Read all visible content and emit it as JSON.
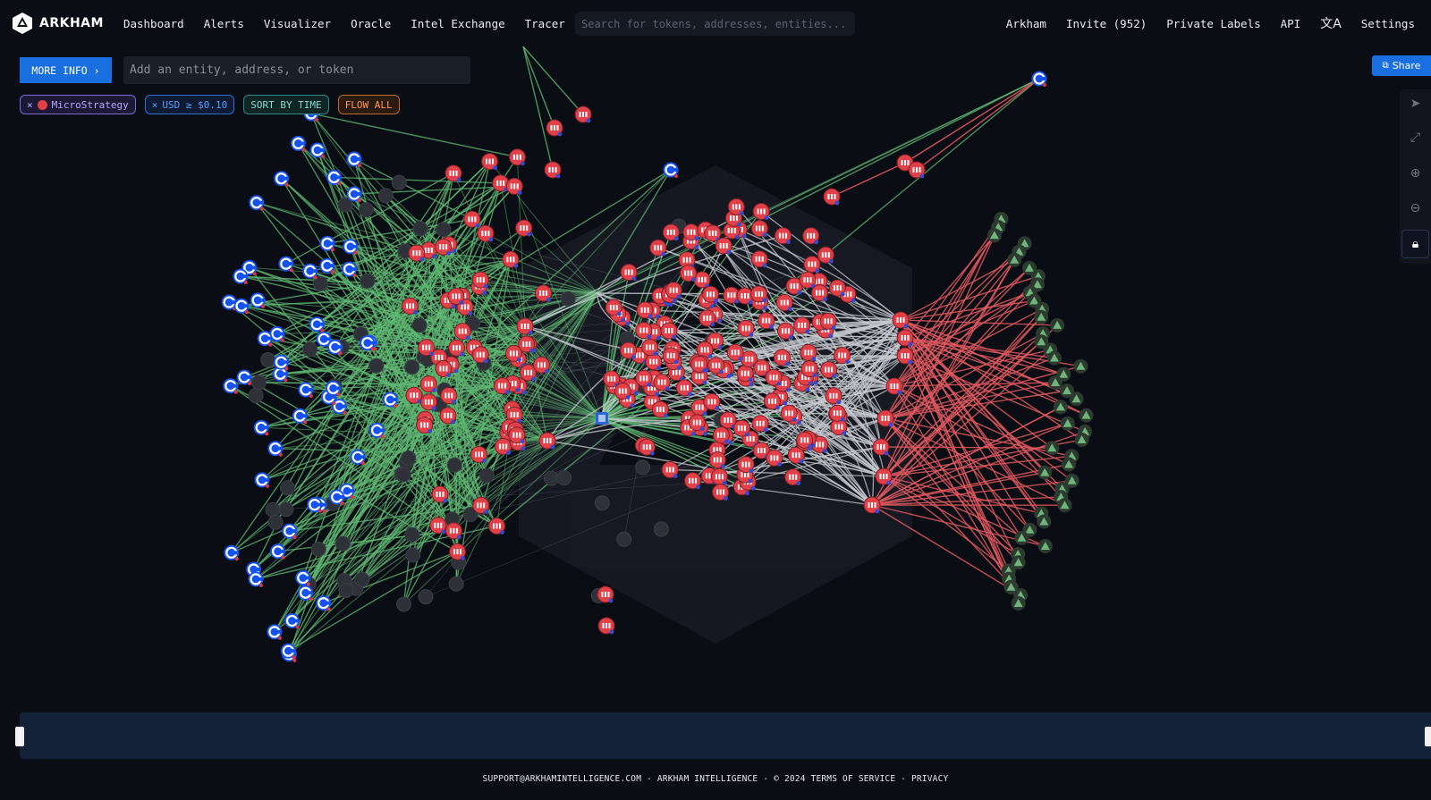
{
  "nav": {
    "brand": "ARKHAM",
    "links": [
      "Dashboard",
      "Alerts",
      "Visualizer",
      "Oracle",
      "Intel Exchange",
      "Tracer"
    ],
    "search_placeholder": "Search for tokens, addresses, entities...",
    "right_links": [
      "Arkham",
      "Invite (952)",
      "Private Labels",
      "API",
      "Settings"
    ]
  },
  "toolbar": {
    "more_info": "MORE INFO ›",
    "entity_placeholder": "Add an entity, address, or token",
    "share": "Share"
  },
  "filters": {
    "entity": "MicroStrategy",
    "usd": "USD ≥ $0.10",
    "sort": "SORT BY TIME",
    "flow": "FLOW ALL"
  },
  "side_tools": [
    "cursor-icon",
    "fit-screen-icon",
    "zoom-in-icon",
    "zoom-out-icon",
    "lock-icon"
  ],
  "footer": {
    "text": "SUPPORT@ARKHAMINTELLIGENCE.COM - ARKHAM INTELLIGENCE - © 2024  TERMS OF SERVICE - PRIVACY"
  },
  "colors": {
    "accent_blue": "#1a6fe0",
    "inflow_green": "#5fb872",
    "outflow_red": "#e1595f",
    "microstrategy_red": "#e24048",
    "coinbase_blue": "#1652f0",
    "internal_grey": "#c7c9cf",
    "background": "#0b0d14"
  },
  "graph": {
    "node_types": [
      "microstrategy-entity",
      "coinbase-address",
      "unlabeled-address",
      "pyramid-entity"
    ],
    "edge_types": [
      "inflow",
      "outflow",
      "internal"
    ]
  }
}
